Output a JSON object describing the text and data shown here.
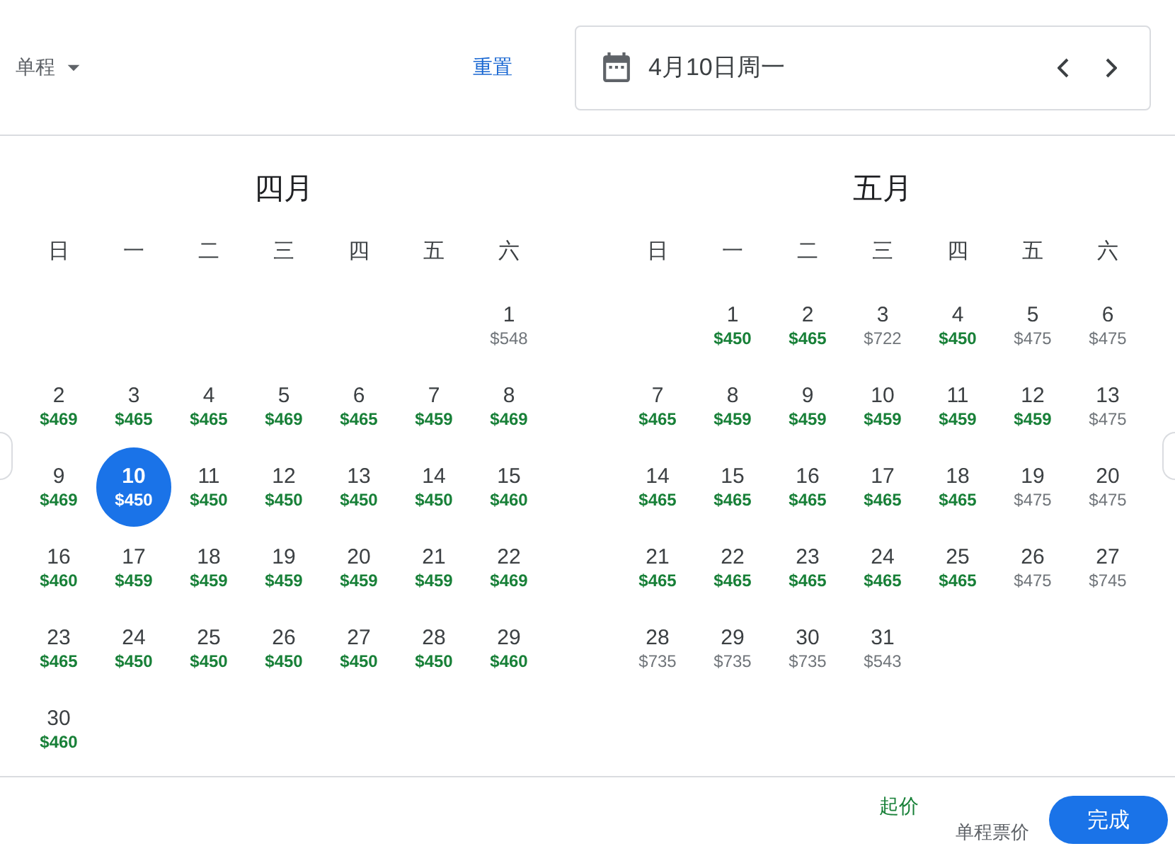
{
  "header": {
    "trip_type": "单程",
    "reset": "重置",
    "date_field": {
      "value": "4月10日周一"
    }
  },
  "months": [
    {
      "title": "四月",
      "weekdays": [
        "日",
        "一",
        "二",
        "三",
        "四",
        "五",
        "六"
      ],
      "weeks": [
        [
          {
            "day": "1",
            "price": "$548",
            "low": false,
            "selected": false
          }
        ],
        [
          {
            "day": "2",
            "price": "$469",
            "low": true,
            "selected": false
          },
          {
            "day": "3",
            "price": "$465",
            "low": true,
            "selected": false
          },
          {
            "day": "4",
            "price": "$465",
            "low": true,
            "selected": false
          },
          {
            "day": "5",
            "price": "$469",
            "low": true,
            "selected": false
          },
          {
            "day": "6",
            "price": "$465",
            "low": true,
            "selected": false
          },
          {
            "day": "7",
            "price": "$459",
            "low": true,
            "selected": false
          },
          {
            "day": "8",
            "price": "$469",
            "low": true,
            "selected": false
          }
        ],
        [
          {
            "day": "9",
            "price": "$469",
            "low": true,
            "selected": false
          },
          {
            "day": "10",
            "price": "$450",
            "low": true,
            "selected": true
          },
          {
            "day": "11",
            "price": "$450",
            "low": true,
            "selected": false
          },
          {
            "day": "12",
            "price": "$450",
            "low": true,
            "selected": false
          },
          {
            "day": "13",
            "price": "$450",
            "low": true,
            "selected": false
          },
          {
            "day": "14",
            "price": "$450",
            "low": true,
            "selected": false
          },
          {
            "day": "15",
            "price": "$460",
            "low": true,
            "selected": false
          }
        ],
        [
          {
            "day": "16",
            "price": "$460",
            "low": true,
            "selected": false
          },
          {
            "day": "17",
            "price": "$459",
            "low": true,
            "selected": false
          },
          {
            "day": "18",
            "price": "$459",
            "low": true,
            "selected": false
          },
          {
            "day": "19",
            "price": "$459",
            "low": true,
            "selected": false
          },
          {
            "day": "20",
            "price": "$459",
            "low": true,
            "selected": false
          },
          {
            "day": "21",
            "price": "$459",
            "low": true,
            "selected": false
          },
          {
            "day": "22",
            "price": "$469",
            "low": true,
            "selected": false
          }
        ],
        [
          {
            "day": "23",
            "price": "$465",
            "low": true,
            "selected": false
          },
          {
            "day": "24",
            "price": "$450",
            "low": true,
            "selected": false
          },
          {
            "day": "25",
            "price": "$450",
            "low": true,
            "selected": false
          },
          {
            "day": "26",
            "price": "$450",
            "low": true,
            "selected": false
          },
          {
            "day": "27",
            "price": "$450",
            "low": true,
            "selected": false
          },
          {
            "day": "28",
            "price": "$450",
            "low": true,
            "selected": false
          },
          {
            "day": "29",
            "price": "$460",
            "low": true,
            "selected": false
          }
        ],
        [
          {
            "day": "30",
            "price": "$460",
            "low": true,
            "selected": false
          }
        ]
      ]
    },
    {
      "title": "五月",
      "weekdays": [
        "日",
        "一",
        "二",
        "三",
        "四",
        "五",
        "六"
      ],
      "weeks": [
        [
          {
            "day": "1",
            "price": "$450",
            "low": true,
            "selected": false
          },
          {
            "day": "2",
            "price": "$465",
            "low": true,
            "selected": false
          },
          {
            "day": "3",
            "price": "$722",
            "low": false,
            "selected": false
          },
          {
            "day": "4",
            "price": "$450",
            "low": true,
            "selected": false
          },
          {
            "day": "5",
            "price": "$475",
            "low": false,
            "selected": false
          },
          {
            "day": "6",
            "price": "$475",
            "low": false,
            "selected": false
          }
        ],
        [
          {
            "day": "7",
            "price": "$465",
            "low": true,
            "selected": false
          },
          {
            "day": "8",
            "price": "$459",
            "low": true,
            "selected": false
          },
          {
            "day": "9",
            "price": "$459",
            "low": true,
            "selected": false
          },
          {
            "day": "10",
            "price": "$459",
            "low": true,
            "selected": false
          },
          {
            "day": "11",
            "price": "$459",
            "low": true,
            "selected": false
          },
          {
            "day": "12",
            "price": "$459",
            "low": true,
            "selected": false
          },
          {
            "day": "13",
            "price": "$475",
            "low": false,
            "selected": false
          }
        ],
        [
          {
            "day": "14",
            "price": "$465",
            "low": true,
            "selected": false
          },
          {
            "day": "15",
            "price": "$465",
            "low": true,
            "selected": false
          },
          {
            "day": "16",
            "price": "$465",
            "low": true,
            "selected": false
          },
          {
            "day": "17",
            "price": "$465",
            "low": true,
            "selected": false
          },
          {
            "day": "18",
            "price": "$465",
            "low": true,
            "selected": false
          },
          {
            "day": "19",
            "price": "$475",
            "low": false,
            "selected": false
          },
          {
            "day": "20",
            "price": "$475",
            "low": false,
            "selected": false
          }
        ],
        [
          {
            "day": "21",
            "price": "$465",
            "low": true,
            "selected": false
          },
          {
            "day": "22",
            "price": "$465",
            "low": true,
            "selected": false
          },
          {
            "day": "23",
            "price": "$465",
            "low": true,
            "selected": false
          },
          {
            "day": "24",
            "price": "$465",
            "low": true,
            "selected": false
          },
          {
            "day": "25",
            "price": "$465",
            "low": true,
            "selected": false
          },
          {
            "day": "26",
            "price": "$475",
            "low": false,
            "selected": false
          },
          {
            "day": "27",
            "price": "$745",
            "low": false,
            "selected": false
          }
        ],
        [
          {
            "day": "28",
            "price": "$735",
            "low": false,
            "selected": false
          },
          {
            "day": "29",
            "price": "$735",
            "low": false,
            "selected": false
          },
          {
            "day": "30",
            "price": "$735",
            "low": false,
            "selected": false
          },
          {
            "day": "31",
            "price": "$543",
            "low": false,
            "selected": false
          }
        ]
      ]
    }
  ],
  "footer": {
    "price_label": "起价",
    "price_note": "单程票价",
    "done_button": "完成"
  }
}
